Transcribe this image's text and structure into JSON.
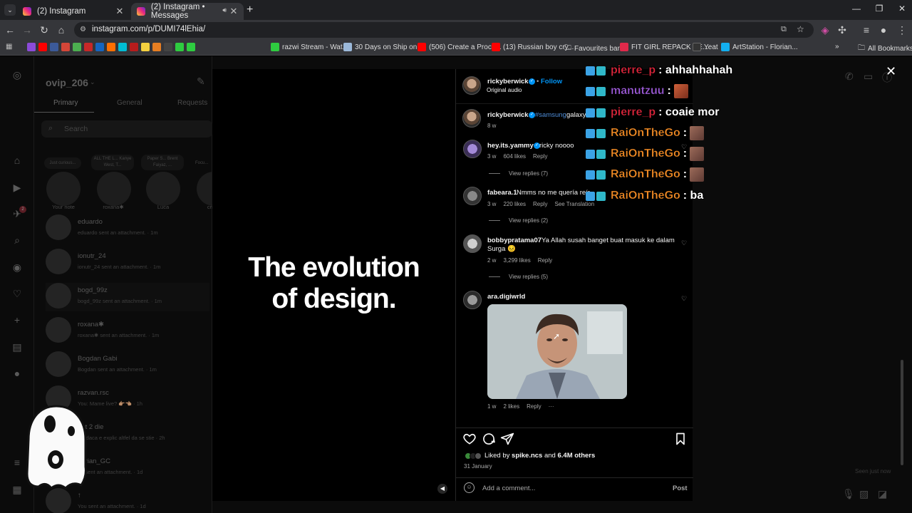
{
  "browser": {
    "tabs": [
      {
        "title": "(2) Instagram"
      },
      {
        "title": "(2) Instagram • Messages"
      }
    ],
    "new_tab": "+",
    "url": "instagram.com/p/DUMI74lEhia/",
    "bookmarks": [
      {
        "label": "razwi Stream - Wat...",
        "color": "#2ecc40"
      },
      {
        "label": "30 Days on Ship on...",
        "color": "#9bb8d9"
      },
      {
        "label": "(506) Create a Proce...",
        "color": "#ff0000"
      },
      {
        "label": "(13) Russian boy cry...",
        "color": "#ff0000"
      },
      {
        "label": "Favourites bar",
        "color": "#c0c0c0"
      },
      {
        "label": "FIT GIRL REPACK SE...",
        "color": "#e0294a"
      },
      {
        "label": "Yeat",
        "color": "#333333"
      },
      {
        "label": "ArtStation - Florian...",
        "color": "#13aff0"
      }
    ],
    "all_bookmarks": "All Bookmarks"
  },
  "inbox": {
    "username": "ovip_206",
    "tabs": [
      "Primary",
      "General",
      "Requests"
    ],
    "search_placeholder": "Search",
    "notes": [
      {
        "bubble": "Just curious...",
        "name": "Your note"
      },
      {
        "bubble": "ALL THE L... Kanye West, T...",
        "name": "roxana✱"
      },
      {
        "bubble": "Paper S... Brent Faiyaz, ...",
        "name": "Luca"
      },
      {
        "bubble": "Focu...",
        "name": "crina"
      }
    ],
    "conversations": [
      {
        "name": "eduardo",
        "preview": "eduardo sent an attachment. · 1m"
      },
      {
        "name": "ionutr_24",
        "preview": "ionutr_24 sent an attachment. · 1m"
      },
      {
        "name": "bogd_99z",
        "preview": "bogd_99z sent an attachment. · 1m"
      },
      {
        "name": "roxana✱",
        "preview": "roxana✱ sent an attachment. · 1m"
      },
      {
        "name": "Bogdan Gabi",
        "preview": "Bogdan sent an attachment. · 1m"
      },
      {
        "name": "razvan.rsc",
        "preview": "You: Mame live? 👉🏽👈🏽 · 1h"
      },
      {
        "name": "ant 2 die",
        "preview": "Ce daca e explic altfel da se stie · 2h"
      },
      {
        "name": "darian_GC",
        "preview": "ou sent an attachment. · 1d"
      },
      {
        "name": "↑",
        "preview": "You sent an attachment. · 1d"
      }
    ],
    "thread_status": "Seen just now",
    "notification_count": "2"
  },
  "post": {
    "caption_line1": "The evolution",
    "caption_line2": "of design.",
    "author": "rickyberwick",
    "follow": "Follow",
    "audio": "Original audio",
    "caption_author": "rickyberwick",
    "caption_tag": "#samsung",
    "caption_text": "galaxy ...",
    "caption_age": "8 w",
    "comments": [
      {
        "user": "hey.its.yammy",
        "text": "ricky noooo",
        "age": "3 w",
        "likes": "604 likes",
        "reply": "Reply",
        "view_replies": "View replies (7)"
      },
      {
        "user": "fabeara.1",
        "text": "Nmms no me quería reír",
        "age": "3 w",
        "likes": "220 likes",
        "reply": "Reply",
        "translate": "See Translation",
        "view_replies": "View replies (2)"
      },
      {
        "user": "bobbypratama07",
        "text": "Ya Allah susah banget buat masuk ke dalam",
        "text2": "Surga 😣",
        "age": "2 w",
        "likes": "3,299 likes",
        "reply": "Reply",
        "view_replies": "View replies (5)"
      },
      {
        "user": "ara.digiwrld",
        "text": "",
        "age": "1 w",
        "likes": "2 likes",
        "reply": "Reply",
        "more": "···"
      }
    ],
    "liked_by_prefix": "Liked by",
    "liked_by_user": "spike.ncs",
    "liked_by_and": "and",
    "liked_by_others": "6.4M others",
    "date": "31 January",
    "comment_placeholder": "Add a comment...",
    "post_button": "Post"
  },
  "chat_overlay": [
    {
      "user": "pierre_p",
      "color": "#e0263c",
      "message": ": ahhahhahah",
      "emote": false
    },
    {
      "user": "manutzuu",
      "color": "#9b59d6",
      "message": ":",
      "emote": true
    },
    {
      "user": "pierre_p",
      "color": "#e0263c",
      "message": ": coaie mor",
      "emote": false
    },
    {
      "user": "RaiOnTheGo",
      "color": "#f08a24",
      "message": ":",
      "emote": true
    },
    {
      "user": "RaiOnTheGo",
      "color": "#f08a24",
      "message": ":",
      "emote": true
    },
    {
      "user": "RaiOnTheGo",
      "color": "#f08a24",
      "message": ":",
      "emote": true
    },
    {
      "user": "RaiOnTheGo",
      "color": "#f08a24",
      "message": ": ba",
      "emote": false
    }
  ]
}
